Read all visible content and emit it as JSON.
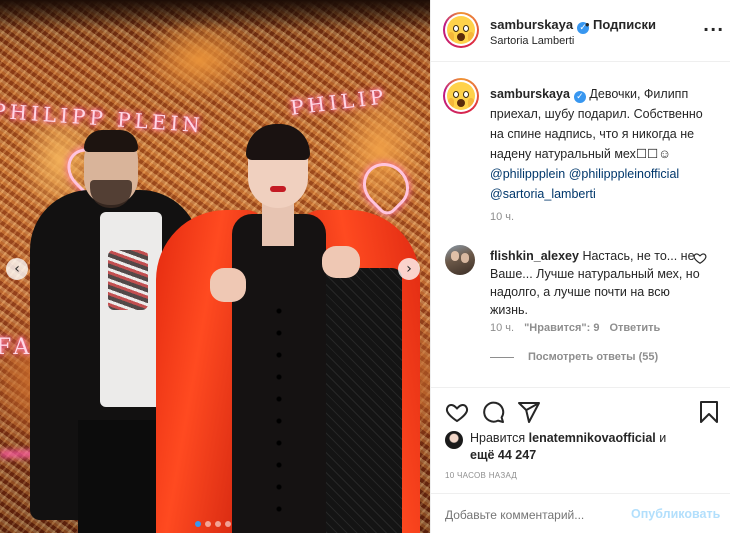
{
  "post": {
    "username": "samburskaya",
    "separator": "•",
    "follow_label": "Подписки",
    "location": "Sartoria Lamberti",
    "more_icon": "more-horizontal-icon"
  },
  "photo": {
    "neon_text_1": "PHILIPP PLEIN",
    "neon_text_2": "PHILIP",
    "neon_text_3": "FAI",
    "slide_count": 4,
    "active_slide": 1,
    "prev_arrow": "‹",
    "next_arrow": "›"
  },
  "caption": {
    "username": "samburskaya",
    "text": "Девочки, Филипп приехал, шубу подарил. Собственно на спине надпись, что я никогда не надену натуральный мех☐☐☺",
    "mentions": [
      "@philippplein",
      "@philipppleinofficial",
      "@sartoria_lamberti"
    ],
    "time": "10 ч."
  },
  "comment": {
    "username": "flishkin_alexey",
    "text": "Настась, не то... не Ваше... Лучше натуральный мех, но надолго, а лучше почти на всю жизнь.",
    "time": "10 ч.",
    "likes_label": "\"Нравится\": 9",
    "reply_label": "Ответить",
    "view_replies": "Посмотреть ответы (55)"
  },
  "actions": {
    "like_icon": "heart-icon",
    "comment_icon": "comment-icon",
    "share_icon": "share-icon",
    "save_icon": "bookmark-icon"
  },
  "likes": {
    "prefix": "Нравится",
    "user": "lenatemnikovaofficial",
    "middle": "и",
    "count_text": "ещё 44 247"
  },
  "post_time": "10 часов назад",
  "composer": {
    "placeholder": "Добавьте комментарий...",
    "publish_label": "Опубликовать"
  },
  "colors": {
    "link": "#00376b",
    "verified": "#3897f0",
    "muted": "#8e8e8e",
    "publish_disabled": "#b2dffc"
  }
}
